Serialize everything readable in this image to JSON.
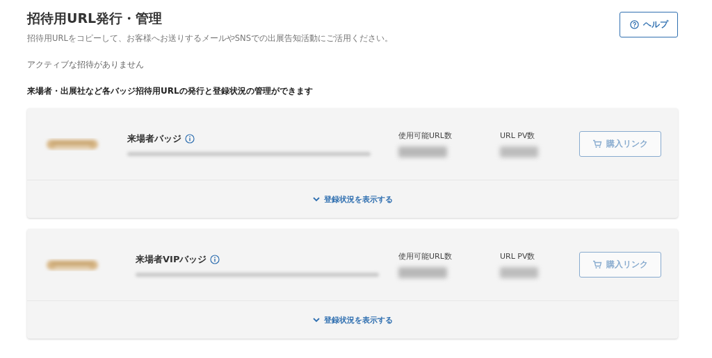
{
  "header": {
    "title": "招待用URL発行・管理",
    "description": "招待用URLをコピーして、お客様へお送りするメールやSNSでの出展告知活動にご活用ください。",
    "help_button": "ヘルプ"
  },
  "notice": "アクティブな招待がありません",
  "section_heading": "来場者・出展社など各バッジ招待用URLの発行と登録状況の管理ができます",
  "badges": [
    {
      "name": "来場者バッジ",
      "available_label": "使用可能URL数",
      "pv_label": "URL PV数",
      "buy_button": {
        "label": "購入リンク",
        "disabled": true
      },
      "toggle": "登録状況を表示する",
      "expanded": false
    },
    {
      "name": "来場者VIPバッジ",
      "available_label": "使用可能URL数",
      "pv_label": "URL PV数",
      "buy_button": {
        "label": "購入リンク",
        "disabled": true
      },
      "toggle": "登録状況を表示する",
      "expanded": false
    }
  ]
}
